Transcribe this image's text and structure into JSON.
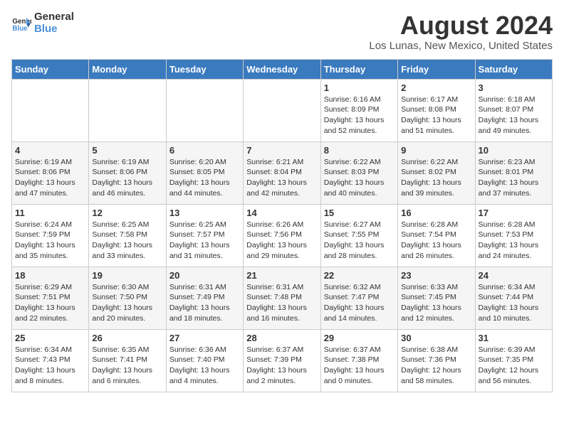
{
  "header": {
    "logo_line1": "General",
    "logo_line2": "Blue",
    "month_year": "August 2024",
    "location": "Los Lunas, New Mexico, United States"
  },
  "calendar": {
    "weekdays": [
      "Sunday",
      "Monday",
      "Tuesday",
      "Wednesday",
      "Thursday",
      "Friday",
      "Saturday"
    ],
    "weeks": [
      [
        {
          "day": "",
          "info": ""
        },
        {
          "day": "",
          "info": ""
        },
        {
          "day": "",
          "info": ""
        },
        {
          "day": "",
          "info": ""
        },
        {
          "day": "1",
          "info": "Sunrise: 6:16 AM\nSunset: 8:09 PM\nDaylight: 13 hours\nand 52 minutes."
        },
        {
          "day": "2",
          "info": "Sunrise: 6:17 AM\nSunset: 8:08 PM\nDaylight: 13 hours\nand 51 minutes."
        },
        {
          "day": "3",
          "info": "Sunrise: 6:18 AM\nSunset: 8:07 PM\nDaylight: 13 hours\nand 49 minutes."
        }
      ],
      [
        {
          "day": "4",
          "info": "Sunrise: 6:19 AM\nSunset: 8:06 PM\nDaylight: 13 hours\nand 47 minutes."
        },
        {
          "day": "5",
          "info": "Sunrise: 6:19 AM\nSunset: 8:06 PM\nDaylight: 13 hours\nand 46 minutes."
        },
        {
          "day": "6",
          "info": "Sunrise: 6:20 AM\nSunset: 8:05 PM\nDaylight: 13 hours\nand 44 minutes."
        },
        {
          "day": "7",
          "info": "Sunrise: 6:21 AM\nSunset: 8:04 PM\nDaylight: 13 hours\nand 42 minutes."
        },
        {
          "day": "8",
          "info": "Sunrise: 6:22 AM\nSunset: 8:03 PM\nDaylight: 13 hours\nand 40 minutes."
        },
        {
          "day": "9",
          "info": "Sunrise: 6:22 AM\nSunset: 8:02 PM\nDaylight: 13 hours\nand 39 minutes."
        },
        {
          "day": "10",
          "info": "Sunrise: 6:23 AM\nSunset: 8:01 PM\nDaylight: 13 hours\nand 37 minutes."
        }
      ],
      [
        {
          "day": "11",
          "info": "Sunrise: 6:24 AM\nSunset: 7:59 PM\nDaylight: 13 hours\nand 35 minutes."
        },
        {
          "day": "12",
          "info": "Sunrise: 6:25 AM\nSunset: 7:58 PM\nDaylight: 13 hours\nand 33 minutes."
        },
        {
          "day": "13",
          "info": "Sunrise: 6:25 AM\nSunset: 7:57 PM\nDaylight: 13 hours\nand 31 minutes."
        },
        {
          "day": "14",
          "info": "Sunrise: 6:26 AM\nSunset: 7:56 PM\nDaylight: 13 hours\nand 29 minutes."
        },
        {
          "day": "15",
          "info": "Sunrise: 6:27 AM\nSunset: 7:55 PM\nDaylight: 13 hours\nand 28 minutes."
        },
        {
          "day": "16",
          "info": "Sunrise: 6:28 AM\nSunset: 7:54 PM\nDaylight: 13 hours\nand 26 minutes."
        },
        {
          "day": "17",
          "info": "Sunrise: 6:28 AM\nSunset: 7:53 PM\nDaylight: 13 hours\nand 24 minutes."
        }
      ],
      [
        {
          "day": "18",
          "info": "Sunrise: 6:29 AM\nSunset: 7:51 PM\nDaylight: 13 hours\nand 22 minutes."
        },
        {
          "day": "19",
          "info": "Sunrise: 6:30 AM\nSunset: 7:50 PM\nDaylight: 13 hours\nand 20 minutes."
        },
        {
          "day": "20",
          "info": "Sunrise: 6:31 AM\nSunset: 7:49 PM\nDaylight: 13 hours\nand 18 minutes."
        },
        {
          "day": "21",
          "info": "Sunrise: 6:31 AM\nSunset: 7:48 PM\nDaylight: 13 hours\nand 16 minutes."
        },
        {
          "day": "22",
          "info": "Sunrise: 6:32 AM\nSunset: 7:47 PM\nDaylight: 13 hours\nand 14 minutes."
        },
        {
          "day": "23",
          "info": "Sunrise: 6:33 AM\nSunset: 7:45 PM\nDaylight: 13 hours\nand 12 minutes."
        },
        {
          "day": "24",
          "info": "Sunrise: 6:34 AM\nSunset: 7:44 PM\nDaylight: 13 hours\nand 10 minutes."
        }
      ],
      [
        {
          "day": "25",
          "info": "Sunrise: 6:34 AM\nSunset: 7:43 PM\nDaylight: 13 hours\nand 8 minutes."
        },
        {
          "day": "26",
          "info": "Sunrise: 6:35 AM\nSunset: 7:41 PM\nDaylight: 13 hours\nand 6 minutes."
        },
        {
          "day": "27",
          "info": "Sunrise: 6:36 AM\nSunset: 7:40 PM\nDaylight: 13 hours\nand 4 minutes."
        },
        {
          "day": "28",
          "info": "Sunrise: 6:37 AM\nSunset: 7:39 PM\nDaylight: 13 hours\nand 2 minutes."
        },
        {
          "day": "29",
          "info": "Sunrise: 6:37 AM\nSunset: 7:38 PM\nDaylight: 13 hours\nand 0 minutes."
        },
        {
          "day": "30",
          "info": "Sunrise: 6:38 AM\nSunset: 7:36 PM\nDaylight: 12 hours\nand 58 minutes."
        },
        {
          "day": "31",
          "info": "Sunrise: 6:39 AM\nSunset: 7:35 PM\nDaylight: 12 hours\nand 56 minutes."
        }
      ]
    ]
  }
}
